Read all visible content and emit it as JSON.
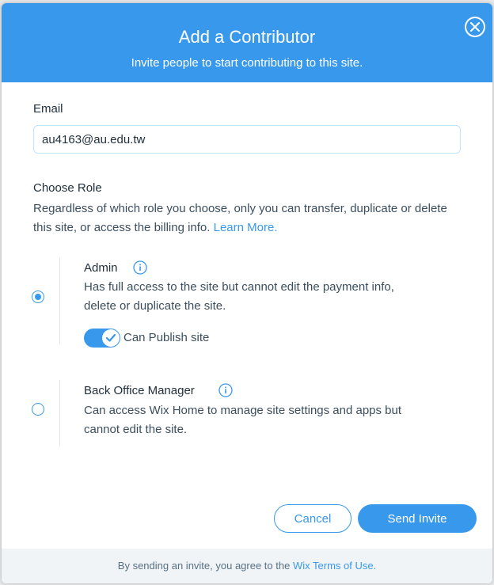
{
  "dialog": {
    "title": "Add a Contributor",
    "subtitle": "Invite people to start contributing to this site.",
    "close_icon": "close-icon"
  },
  "email": {
    "label": "Email",
    "value": "au4163@au.edu.tw"
  },
  "role": {
    "heading": "Choose Role",
    "description": "Regardless of which role you choose, only you can transfer, duplicate or delete this site, or access the billing info.",
    "learn_more": "Learn More."
  },
  "roles": [
    {
      "name": "Admin",
      "description": "Has full access to the site but cannot edit the payment info, delete or duplicate the site.",
      "selected": true,
      "toggle_label": "Can Publish site",
      "toggle_on": true
    },
    {
      "name": "Back Office Manager",
      "description": "Can access Wix Home to manage site settings and apps but cannot edit the site.",
      "selected": false
    }
  ],
  "buttons": {
    "cancel": "Cancel",
    "send": "Send Invite"
  },
  "footer": {
    "text": "By sending an invite, you agree to the",
    "link": "Wix Terms of Use."
  },
  "colors": {
    "accent": "#3899ec",
    "footer_bg": "#f0f4f7"
  }
}
